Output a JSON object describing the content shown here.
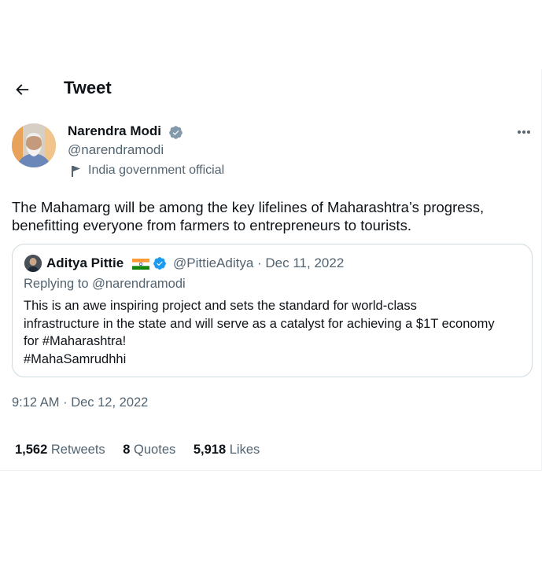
{
  "header": {
    "title": "Tweet",
    "back_icon": "arrow-left-icon"
  },
  "author": {
    "name": "Narendra Modi",
    "handle": "@narendramodi",
    "verified_icon": "verified-badge-icon",
    "affiliation_icon": "flag-icon",
    "affiliation_label": "India government official"
  },
  "more_icon": "more-dots-icon",
  "tweet": {
    "text": "The Mahamarg will be among the key lifelines of Maharashtra’s progress, benefitting everyone from farmers to entrepreneurs to tourists.",
    "timestamp": "9:12 AM · Dec 12, 2022"
  },
  "quote": {
    "name": "Aditya Pittie",
    "flag_icon": "india-flag-icon",
    "verified_icon": "verified-badge-icon",
    "handle_date": "@PittieAditya · Dec 11, 2022",
    "replying": "Replying to @narendramodi",
    "body": "This is an awe inspiring project and sets the standard for world-class infrastructure in the state and will serve as a catalyst for achieving a $1T economy for #Maharashtra!\n #MahaSamrudhhi"
  },
  "stats": [
    {
      "num": "1,562",
      "label": "Retweets"
    },
    {
      "num": "8",
      "label": "Quotes"
    },
    {
      "num": "5,918",
      "label": "Likes"
    }
  ],
  "colors": {
    "text": "#0f1419",
    "secondary": "#536471",
    "verified": "#1d9bf0",
    "border": "#cfd9de"
  }
}
